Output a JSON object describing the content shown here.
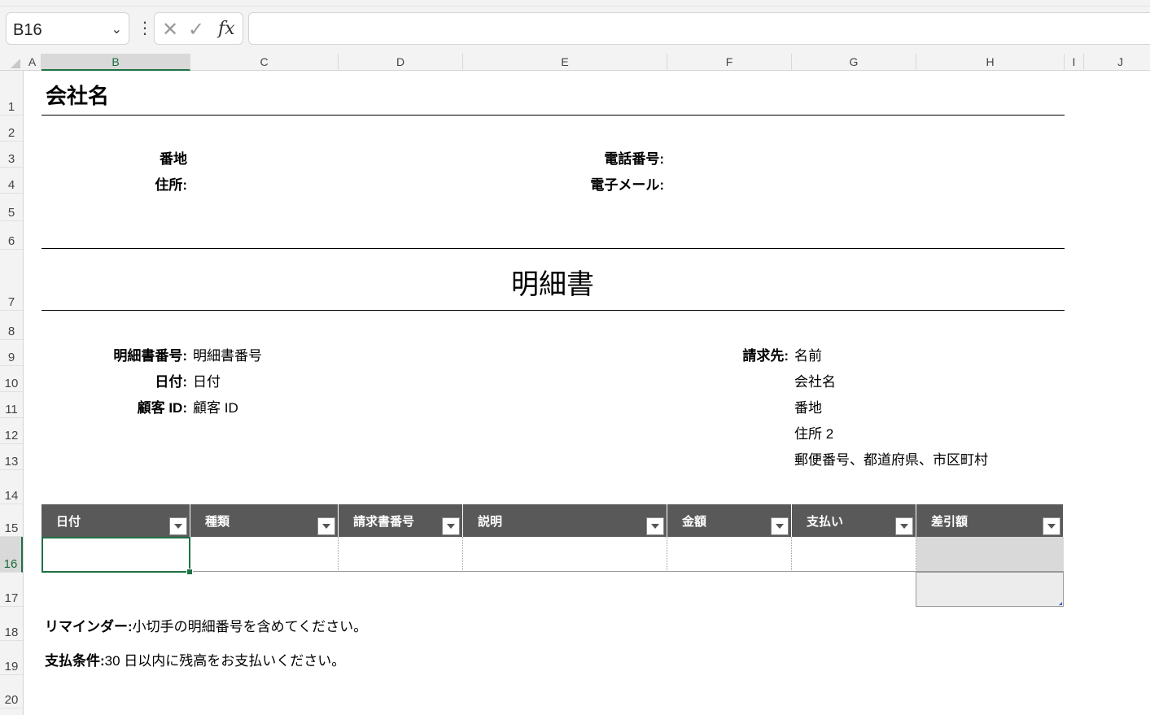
{
  "formula_bar": {
    "name_box": "B16",
    "chevron": "⌄",
    "more": "⋮",
    "cancel": "✕",
    "enter": "✓",
    "fx": "fx",
    "formula": ""
  },
  "columns": [
    "A",
    "B",
    "C",
    "D",
    "E",
    "F",
    "G",
    "H",
    "I",
    "J"
  ],
  "rows": [
    "1",
    "2",
    "3",
    "4",
    "5",
    "6",
    "7",
    "8",
    "9",
    "10",
    "11",
    "12",
    "13",
    "14",
    "15",
    "16",
    "17",
    "18",
    "19",
    "20"
  ],
  "header": {
    "company": "会社名",
    "street_label": "番地",
    "address_label": "住所:",
    "phone_label": "電話番号:",
    "email_label": "電子メール:"
  },
  "title": "明細書",
  "details": {
    "statement_no_label": "明細書番号:",
    "statement_no_value": "明細書番号",
    "date_label": "日付:",
    "date_value": "日付",
    "customer_id_label": "顧客 ID:",
    "customer_id_value": "顧客 ID",
    "bill_to_label": "請求先:",
    "bill_to_lines": [
      "名前",
      "会社名",
      "番地",
      "住所 2",
      "郵便番号、都道府県、市区町村"
    ]
  },
  "table": {
    "headers": [
      "日付",
      "種類",
      "請求書番号",
      "説明",
      "金額",
      "支払い",
      "差引額"
    ]
  },
  "footer": {
    "reminder_label": "リマインダー:",
    "reminder_text": "小切手の明細番号を含めてください。",
    "terms_label": "支払条件:",
    "terms_text": "30 日以内に残高をお支払いください。"
  },
  "colors": {
    "table_header": "#595959",
    "selection": "#1e7145",
    "balance_fill": "#d9d9d9"
  }
}
